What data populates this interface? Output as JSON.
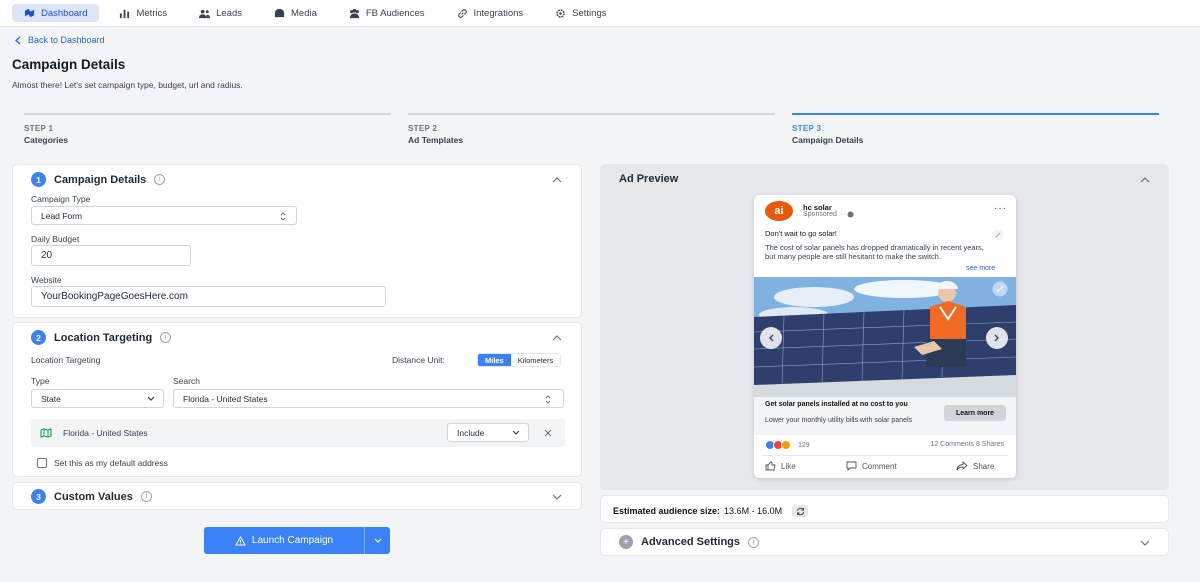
{
  "nav": {
    "items": [
      {
        "label": "Dashboard",
        "icon": "map-pin-icon",
        "active": true
      },
      {
        "label": "Metrics",
        "icon": "bar-chart-icon",
        "active": false
      },
      {
        "label": "Leads",
        "icon": "users-icon",
        "active": false
      },
      {
        "label": "Media",
        "icon": "media-icon",
        "active": false
      },
      {
        "label": "FB Audiences",
        "icon": "users-group-icon",
        "active": false
      },
      {
        "label": "Integrations",
        "icon": "link-icon",
        "active": false
      },
      {
        "label": "Settings",
        "icon": "gear-icon",
        "active": false
      }
    ]
  },
  "page": {
    "back_label": "Back to Dashboard",
    "title": "Campaign Details",
    "subtitle": "Almost there! Let's set campaign type, budget, url and radius."
  },
  "steps": [
    {
      "label": "STEP 1",
      "name": "Categories",
      "active": false
    },
    {
      "label": "STEP 2",
      "name": "Ad Templates",
      "active": false
    },
    {
      "label": "STEP 3",
      "name": "Campaign Details",
      "active": true
    }
  ],
  "campaign": {
    "number": "1",
    "title": "Campaign Details",
    "type_label": "Campaign Type",
    "type_value": "Lead Form",
    "budget_label": "Daily Budget",
    "budget_value": "20",
    "website_label": "Website",
    "website_value": "YourBookingPageGoesHere.com"
  },
  "location": {
    "number": "2",
    "title": "Location Targeting",
    "sub_label": "Location Targeting",
    "distance_label": "Distance Unit:",
    "unit_miles": "Miles",
    "unit_km": "Kilometers",
    "selected_unit": "Miles",
    "type_label": "Type",
    "type_value": "State",
    "search_label": "Search",
    "search_value": "Florida - United States",
    "item_text": "Florida - United States",
    "item_mode": "Include",
    "default_label": "Set this as my default address"
  },
  "custom": {
    "number": "3",
    "title": "Custom Values"
  },
  "launch_label": "Launch Campaign",
  "preview": {
    "title": "Ad Preview",
    "page_name": "hc solar",
    "sponsored": "Sponsored",
    "headline_text": "Don't wait to go solar!",
    "body_text": "The cost of solar panels has dropped dramatically in recent years, but many people are still hesitant to make the switch.",
    "see_more": "see more",
    "cta_title": "Get solar panels installed at no cost to you",
    "cta_sub": "Lower your monthly utility bills with solar panels",
    "cta_button": "Learn more",
    "reactions_count": "129",
    "comments_shares": "12 Comments 8 Shares",
    "like": "Like",
    "comment": "Comment",
    "share": "Share",
    "logo_text": "ai"
  },
  "audience": {
    "label": "Estimated audience size:",
    "value": "13.6M - 16.0M"
  },
  "advanced": {
    "icon_glyph": "+",
    "title": "Advanced Settings"
  },
  "colors": {
    "accent": "#3b82f6",
    "nav_active_bg": "#dde5f6",
    "page_bg": "#f3f4f6"
  }
}
